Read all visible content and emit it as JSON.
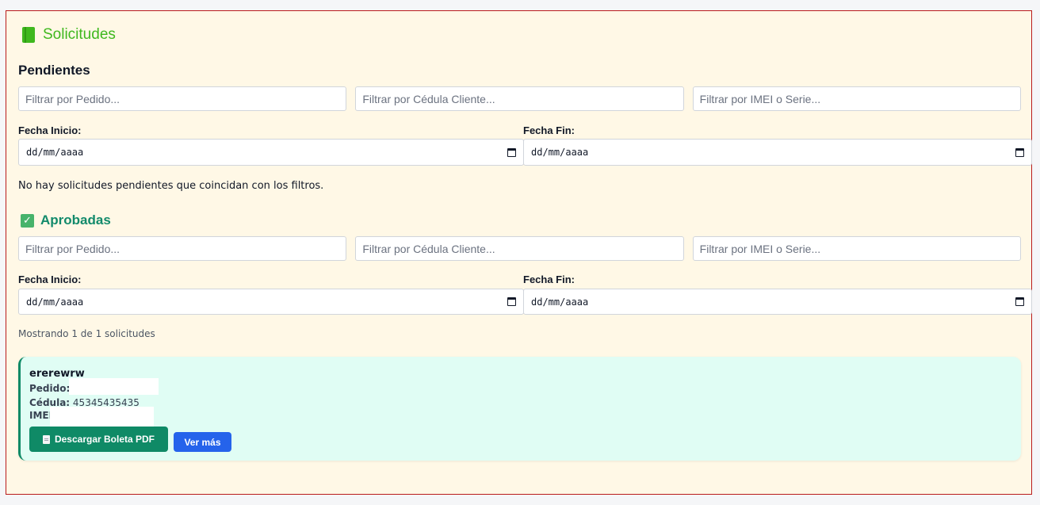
{
  "header": {
    "icon": "book-icon",
    "title": "Solicitudes"
  },
  "pendientes": {
    "heading": "Pendientes",
    "filters": {
      "pedido_placeholder": "Filtrar por Pedido...",
      "cedula_placeholder": "Filtrar por Cédula Cliente...",
      "imei_placeholder": "Filtrar por IMEI o Serie..."
    },
    "fecha_inicio_label": "Fecha Inicio:",
    "fecha_inicio_value": "dd/mm/aaaa",
    "fecha_fin_label": "Fecha Fin:",
    "fecha_fin_value": "dd/mm/aaaa",
    "empty_message": "No hay solicitudes pendientes que coincidan con los filtros."
  },
  "aprobadas": {
    "icon": "check-box-icon",
    "heading": "Aprobadas",
    "filters": {
      "pedido_placeholder": "Filtrar por Pedido...",
      "cedula_placeholder": "Filtrar por Cédula Cliente...",
      "imei_placeholder": "Filtrar por IMEI o Serie..."
    },
    "fecha_inicio_label": "Fecha Inicio:",
    "fecha_inicio_value": "dd/mm/aaaa",
    "fecha_fin_label": "Fecha Fin:",
    "fecha_fin_value": "dd/mm/aaaa",
    "showing": "Mostrando 1 de 1 solicitudes",
    "items": [
      {
        "name": "ererewrw",
        "pedido_label": "Pedido:",
        "pedido_value": "",
        "cedula_label": "Cédula:",
        "cedula_value": "45345435435",
        "imei_label": "IMEI",
        "imei_value": "",
        "pdf_button": "Descargar Boleta PDF",
        "more_button": "Ver más"
      }
    ]
  },
  "colors": {
    "panel_bg": "#fff8e6",
    "panel_border": "#b91c1c",
    "title_green": "#3fb81e",
    "aprobadas_green": "#128a6b",
    "card_bg": "#e0fdf4",
    "pdf_button_bg": "#0f8a66",
    "more_button_bg": "#2563eb"
  }
}
